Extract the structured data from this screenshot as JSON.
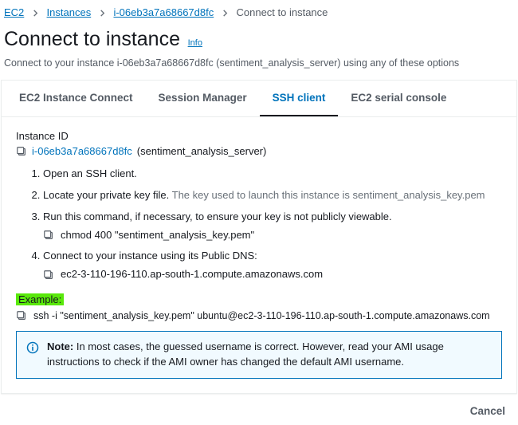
{
  "breadcrumbs": {
    "items": [
      {
        "label": "EC2",
        "link": true
      },
      {
        "label": "Instances",
        "link": true
      },
      {
        "label": "i-06eb3a7a68667d8fc",
        "link": true
      },
      {
        "label": "Connect to instance",
        "link": false
      }
    ]
  },
  "page": {
    "title": "Connect to instance",
    "info": "Info",
    "subtitle": "Connect to your instance i-06eb3a7a68667d8fc (sentiment_analysis_server) using any of these options"
  },
  "tabs": [
    {
      "label": "EC2 Instance Connect",
      "active": false
    },
    {
      "label": "Session Manager",
      "active": false
    },
    {
      "label": "SSH client",
      "active": true
    },
    {
      "label": "EC2 serial console",
      "active": false
    }
  ],
  "instance": {
    "label": "Instance ID",
    "id": "i-06eb3a7a68667d8fc",
    "name": "(sentiment_analysis_server)"
  },
  "steps": {
    "s1": "Open an SSH client.",
    "s2a": "Locate your private key file.",
    "s2b": "The key used to launch this instance is sentiment_analysis_key.pem",
    "s3": "Run this command, if necessary, to ensure your key is not publicly viewable.",
    "s3cmd": "chmod 400 \"sentiment_analysis_key.pem\"",
    "s4": "Connect to your instance using its Public DNS:",
    "s4cmd": "ec2-3-110-196-110.ap-south-1.compute.amazonaws.com"
  },
  "example": {
    "label": "Example:",
    "cmd": "ssh -i \"sentiment_analysis_key.pem\" ubuntu@ec2-3-110-196-110.ap-south-1.compute.amazonaws.com"
  },
  "note": {
    "prefix": "Note:",
    "text": "In most cases, the guessed username is correct. However, read your AMI usage instructions to check if the AMI owner has changed the default AMI username."
  },
  "footer": {
    "cancel": "Cancel"
  }
}
